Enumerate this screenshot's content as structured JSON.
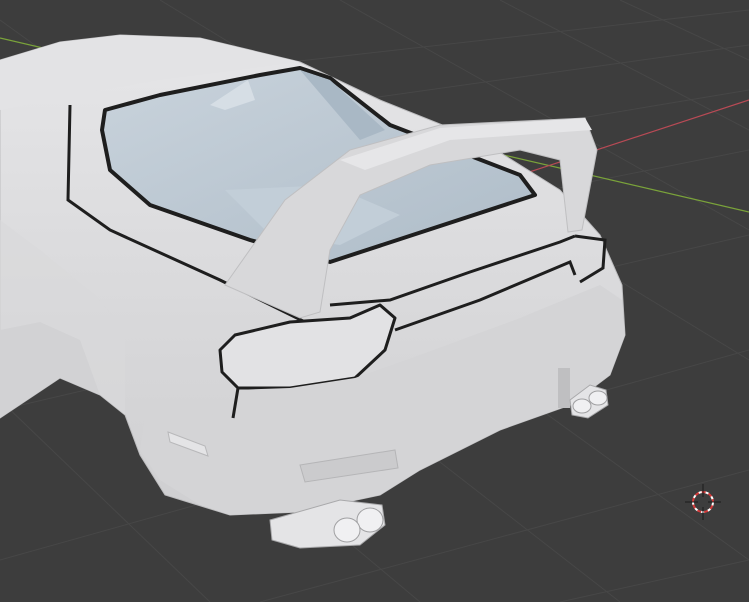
{
  "viewport": {
    "name": "3D Viewport",
    "background_color": "#3d3d3d",
    "grid_color": "#4a4a4a",
    "x_axis_color": "#b84a55",
    "y_axis_color": "#7aa33a",
    "model": {
      "name": "car-body-rear",
      "body_color": "#dcdcde",
      "glass_color": "#bcc8d2",
      "outline_color": "#1e1e1e"
    },
    "cursor_icon": "3d-cursor-icon"
  }
}
